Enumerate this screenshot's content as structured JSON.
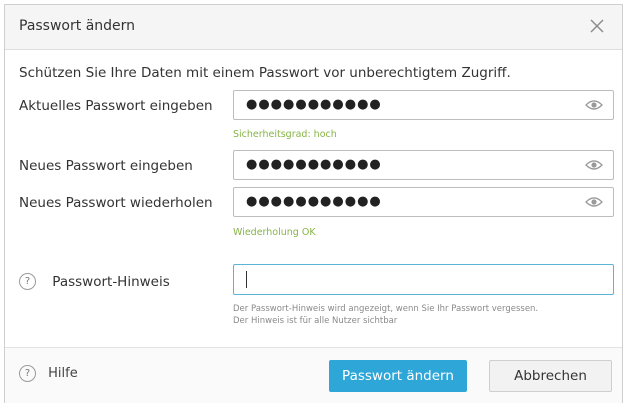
{
  "dialog": {
    "title": "Passwort ändern",
    "intro": "Schützen Sie Ihre Daten mit einem Passwort vor unberechtigtem Zugriff."
  },
  "fields": {
    "current": {
      "label": "Aktuelles Passwort eingeben",
      "value": "●●●●●●●●●●●"
    },
    "strength": "Sicherheitsgrad: hoch",
    "new": {
      "label": "Neues Passwort eingeben",
      "value": "●●●●●●●●●●●"
    },
    "repeat": {
      "label": "Neues Passwort wiederholen",
      "value": "●●●●●●●●●●●"
    },
    "repeat_status": "Wiederholung OK"
  },
  "hint": {
    "icon_glyph": "?",
    "label": "Passwort-Hinweis",
    "value": "",
    "description_1": "Der Passwort-Hinweis wird angezeigt, wenn Sie Ihr Passwort vergessen.",
    "description_2": "Der Hinweis ist für alle Nutzer sichtbar"
  },
  "footer": {
    "help_glyph": "?",
    "help_label": "Hilfe",
    "submit_label": "Passwort ändern",
    "cancel_label": "Abbrechen"
  },
  "icons": {
    "close": "close-icon",
    "eye": "eye-icon",
    "help": "question-circle-icon"
  },
  "colors": {
    "primary": "#2ea6d8",
    "success": "#86b545",
    "focus_border": "#5bb3d6"
  }
}
